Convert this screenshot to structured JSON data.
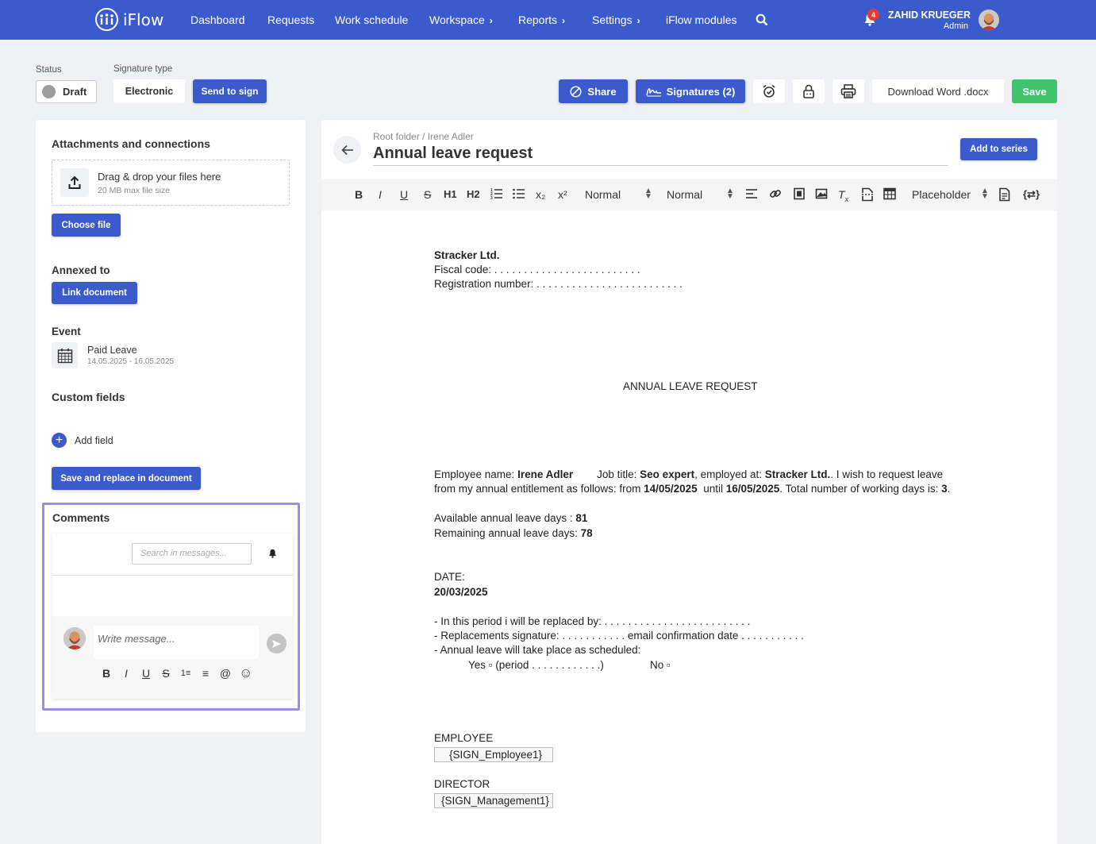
{
  "nav": {
    "logo": "iFlow",
    "items": [
      {
        "label": "Dashboard"
      },
      {
        "label": "Requests"
      },
      {
        "label": "Work schedule"
      },
      {
        "label": "Workspace"
      },
      {
        "label": "Reports"
      },
      {
        "label": "Settings"
      },
      {
        "label": "iFlow modules"
      }
    ],
    "chevron": "›",
    "notifications": "4",
    "user_name": "ZAHID KRUEGER",
    "user_role": "Admin"
  },
  "status_bar": {
    "status_label": "Status",
    "status_value": "Draft",
    "signature_type_label": "Signature type",
    "signature_type_value": "Electronic",
    "send_to_sign": "Send to sign",
    "share": "Share",
    "signatures": "Signatures (2)",
    "download": "Download Word .docx",
    "save": "Save"
  },
  "left": {
    "attachments_title": "Attachments and connections",
    "dropzone_main": "Drag & drop your files here",
    "dropzone_sub": "20 MB max file size",
    "choose_file": "Choose file",
    "annexed_title": "Annexed to",
    "link_document": "Link document",
    "event_title": "Event",
    "event_name": "Paid Leave",
    "event_dates": "14.05.2025 - 16.05.2025",
    "custom_fields_title": "Custom fields",
    "add_field": "Add field",
    "save_replace": "Save and replace in document"
  },
  "comments": {
    "title": "Comments",
    "search_placeholder": "Search in messages...",
    "write_placeholder": "Write message...",
    "tools": [
      "B",
      "I",
      "U",
      "S",
      "1≡",
      "≡",
      "@",
      "☺"
    ]
  },
  "editor": {
    "breadcrumb": "Root folder / Irene Adler",
    "title": "Annual leave request",
    "add_to_series": "Add to series",
    "format_select_1": "Normal",
    "format_select_2": "Normal",
    "placeholder_select": "Placeholder",
    "toolbar_glyphs": {
      "bold": "B",
      "italic": "I",
      "underline": "U",
      "strike": "S",
      "h1": "H1",
      "h2": "H2",
      "sub": "x₂",
      "sup": "x²",
      "code": "{⇄}"
    }
  },
  "document": {
    "company": "Stracker Ltd.",
    "fiscal_code": "Fiscal code:  . . . . . . . . . . . . . . . . . . . . . . . . .",
    "reg_number": "Registration number:  . . . . . . . . . . . . . . . . . . . . . . . . .",
    "heading": "ANNUAL LEAVE REQUEST",
    "p1_a": "Employee name: ",
    "p1_name": "Irene Adler",
    "p1_b": "        Job title: ",
    "p1_job": "Seo expert",
    "p1_c": ", employed at: ",
    "p1_company": "Stracker Ltd.",
    "p1_d": ". I wish to request leave",
    "p2_a": "from my annual entitlement as follows: from ",
    "p2_from": "14/05/2025",
    "p2_b": "  until ",
    "p2_until": "16/05/2025",
    "p2_c": ". Total number of working days is: ",
    "p2_days": "3",
    "p2_d": ".",
    "avail_label": "Available annual leave days : ",
    "avail_value": "81",
    "remain_label": "Remaining annual leave days: ",
    "remain_value": "78",
    "date_label": "DATE:",
    "date_value": "20/03/2025",
    "replaced_by": "- In this period i will be replaced by:  . . . . . . . . . . . . . . . . . . . . . . . . .",
    "replacement_sig": "- Replacements signature: . . . . . . . . . . .  email confirmation date . . . . . . . . . . .",
    "as_scheduled": "- Annual leave will take place as scheduled:",
    "yes_option": "Yes ▫ (period . . . . . . . . . . . .)",
    "no_option": "No ▫",
    "employee_label": "EMPLOYEE",
    "employee_sign": "{SIGN_Employee1}",
    "director_label": "DIRECTOR",
    "director_sign": "{SIGN_Management1}"
  },
  "colors": {
    "primary": "#3b5bcc",
    "save_green": "#3fc36b",
    "badge_red": "#e53935",
    "comments_border": "#9b8de8"
  }
}
